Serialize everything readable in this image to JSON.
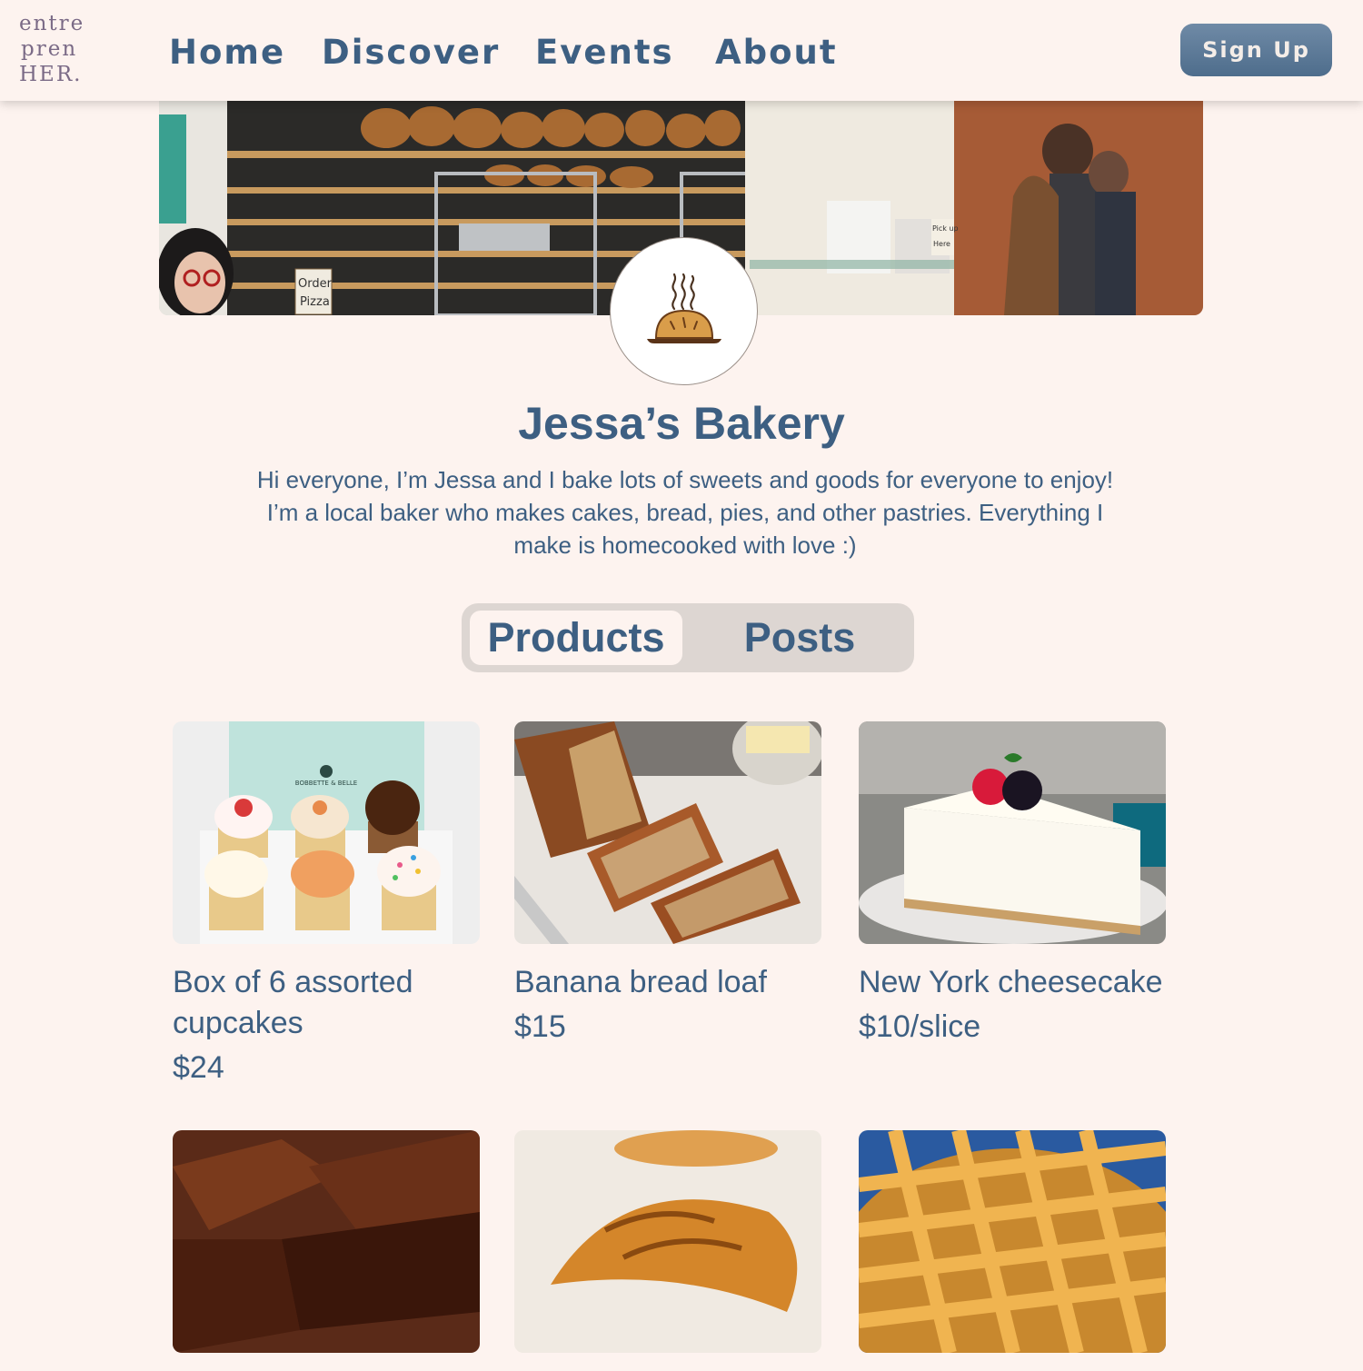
{
  "header": {
    "logo": [
      "entre",
      "pren",
      "HER."
    ],
    "nav": [
      "Home",
      "Discover",
      "Events",
      "About"
    ],
    "signup_label": "Sign Up"
  },
  "banner": {
    "signs": [
      "Order",
      "Pizza",
      "Pick up",
      "Here"
    ]
  },
  "profile": {
    "icon": "bread-steam-icon",
    "name": "Jessa’s Bakery",
    "bio": "Hi everyone, I’m Jessa and I bake lots of sweets and goods for everyone to enjoy! I’m a local baker who makes cakes, bread, pies, and other pastries. Everything I make is homecooked with love :)"
  },
  "tabs": [
    {
      "label": "Products",
      "active": true
    },
    {
      "label": "Posts",
      "active": false
    }
  ],
  "products": [
    {
      "name": "Box of 6 assorted cupcakes",
      "price": "$24",
      "image": "cupcakes-image",
      "box_brand": "BOBBETTE & BELLE"
    },
    {
      "name": "Banana bread loaf",
      "price": "$15",
      "image": "banana-bread-image"
    },
    {
      "name": "New York cheesecake",
      "price": "$10/slice",
      "image": "cheesecake-image"
    },
    {
      "name": "",
      "price": "",
      "image": "chocolate-cake-image"
    },
    {
      "name": "",
      "price": "",
      "image": "croissant-image"
    },
    {
      "name": "",
      "price": "",
      "image": "lattice-pie-image"
    }
  ],
  "colors": {
    "background": "#fdf3ef",
    "primary_text": "#3d5f82",
    "logo": "#7a6a86",
    "button": "#5a7896",
    "tab_track": "#ddd6d2"
  }
}
